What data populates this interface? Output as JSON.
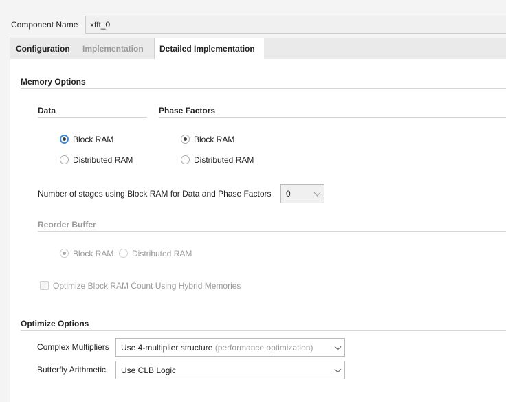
{
  "component": {
    "label": "Component Name",
    "value": "xfft_0"
  },
  "tabs": [
    {
      "label": "Configuration",
      "state": "normal"
    },
    {
      "label": "Implementation",
      "state": "disabled"
    },
    {
      "label": "Detailed Implementation",
      "state": "active"
    }
  ],
  "memory": {
    "title": "Memory Options",
    "data": {
      "title": "Data",
      "options": [
        "Block RAM",
        "Distributed RAM"
      ],
      "selected": "Block RAM"
    },
    "phase": {
      "title": "Phase Factors",
      "options": [
        "Block RAM",
        "Distributed RAM"
      ],
      "selected": "Block RAM"
    },
    "stages": {
      "label": "Number of stages using Block RAM for Data and Phase Factors",
      "value": "0"
    },
    "reorder": {
      "title": "Reorder Buffer",
      "options": [
        "Block RAM",
        "Distributed RAM"
      ],
      "selected": "Block RAM",
      "disabled": true
    },
    "hybrid": {
      "label": "Optimize Block RAM Count Using Hybrid Memories",
      "checked": false,
      "disabled": true
    }
  },
  "optimize": {
    "title": "Optimize Options",
    "complex": {
      "label": "Complex Multipliers",
      "value": "Use 4-multiplier structure",
      "hint": "(performance optimization)"
    },
    "butterfly": {
      "label": "Butterfly Arithmetic",
      "value": "Use CLB Logic"
    }
  },
  "colors": {
    "focus": "#3b8de0",
    "disabled_text": "#999999"
  }
}
